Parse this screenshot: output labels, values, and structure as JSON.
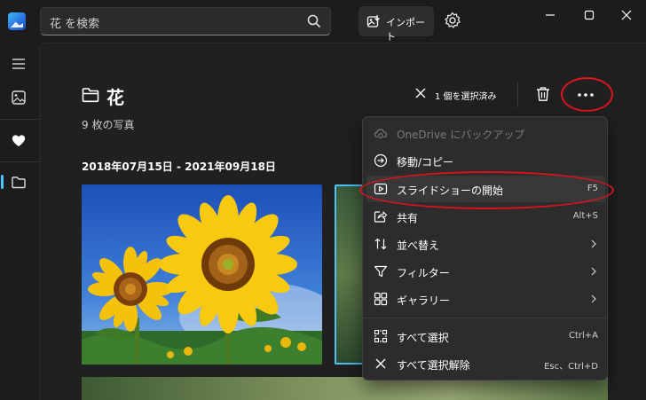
{
  "app": {
    "logo": "photos-app-icon"
  },
  "search": {
    "placeholder": "花 を検索",
    "icon": "search-icon"
  },
  "toolbar": {
    "import_label": "インポート",
    "import_icon": "import-photo-icon",
    "settings_icon": "gear-icon"
  },
  "window": {
    "minimize_icon": "minimize-icon",
    "maximize_icon": "maximize-icon",
    "close_icon": "close-icon"
  },
  "sidebar": {
    "items": [
      {
        "icon": "hamburger-menu-icon"
      },
      {
        "icon": "photos-icon"
      },
      {
        "icon": "heart-icon"
      },
      {
        "icon": "folder-icon",
        "active": true
      }
    ]
  },
  "folder": {
    "title": "花",
    "count_text": "9 枚の写真",
    "date_range": "2018年07月15日 - 2021年09月18日"
  },
  "selection": {
    "label": "1 個を選択済み"
  },
  "menu": {
    "items": [
      {
        "label": "OneDrive にバックアップ",
        "icon": "cloud-backup-icon",
        "disabled": true
      },
      {
        "label": "移動/コピー",
        "icon": "move-copy-icon"
      },
      {
        "label": "スライドショーの開始",
        "icon": "slideshow-icon",
        "shortcut": "F5",
        "highlighted": true
      },
      {
        "label": "共有",
        "icon": "share-icon",
        "shortcut": "Alt+S"
      },
      {
        "label": "並べ替え",
        "icon": "sort-icon",
        "submenu": true
      },
      {
        "label": "フィルター",
        "icon": "filter-icon",
        "submenu": true
      },
      {
        "label": "ギャラリー",
        "icon": "gallery-layout-icon",
        "submenu": true
      },
      {
        "label": "すべて選択",
        "icon": "select-all-icon",
        "shortcut": "Ctrl+A"
      },
      {
        "label": "すべて選択解除",
        "icon": "deselect-icon",
        "shortcut": "Esc、Ctrl+D"
      }
    ]
  },
  "colors": {
    "accent": "#4cc2ff",
    "annotation_red": "#e0141e",
    "background": "#202020",
    "menu_bg": "#2c2c2c"
  }
}
